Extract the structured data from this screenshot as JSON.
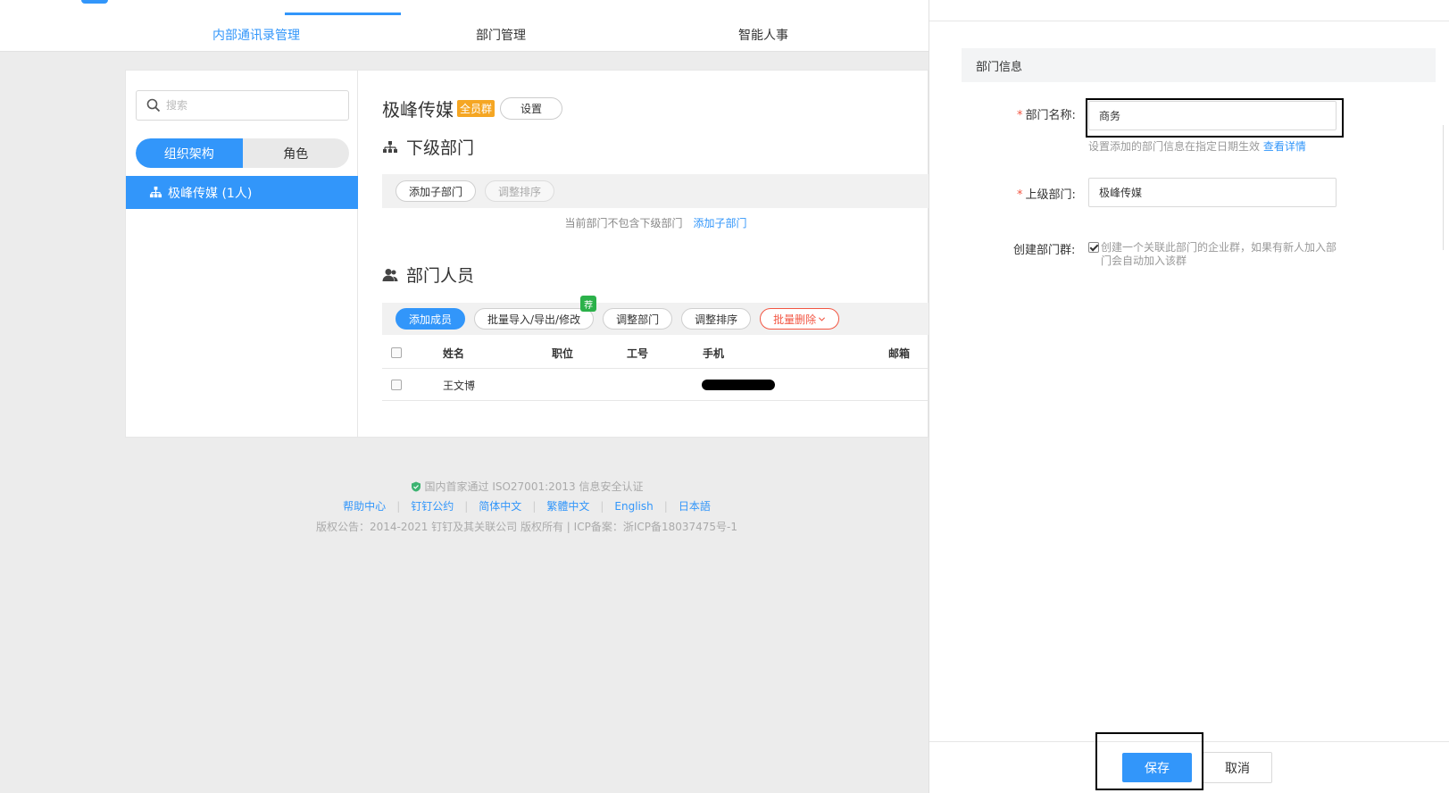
{
  "nav": {
    "tabs": [
      {
        "label": "内部通讯录管理",
        "active": true
      },
      {
        "label": "部门管理",
        "active": false
      },
      {
        "label": "智能人事",
        "active": false
      }
    ]
  },
  "sidebar": {
    "search_placeholder": "搜索",
    "segments": [
      "组织架构",
      "角色"
    ],
    "tree_item": "极峰传媒 (1人)"
  },
  "main": {
    "org_name": "极峰传媒",
    "org_badge": "全员群",
    "settings_button": "设置",
    "sub_dept_title": "下级部门",
    "add_sub_dept_button": "添加子部门",
    "sort_button": "调整排序",
    "empty_text": "当前部门不包含下级部门",
    "empty_link": "添加子部门",
    "members_title": "部门人员",
    "member_buttons": {
      "add": "添加成员",
      "batch_import": "批量导入/导出/修改",
      "recommend_tag": "荐",
      "adjust_dept": "调整部门",
      "adjust_sort": "调整排序",
      "batch_delete": "批量删除"
    },
    "table": {
      "headers": [
        "姓名",
        "职位",
        "工号",
        "手机",
        "邮箱"
      ],
      "rows": [
        {
          "name": "王文博",
          "position": "",
          "job_no": "",
          "phone_redacted": true,
          "email": ""
        }
      ]
    }
  },
  "footer": {
    "cert": "国内首家通过 ISO27001:2013 信息安全认证",
    "links": [
      "帮助中心",
      "钉钉公约",
      "简体中文",
      "繁體中文",
      "English",
      "日本語"
    ],
    "copyright": "版权公告：2014-2021 钉钉及其关联公司 版权所有 | ICP备案：浙ICP备18037475号-1"
  },
  "drawer": {
    "section_title": "部门信息",
    "dept_name_label": "部门名称:",
    "dept_name_value": "商务",
    "dept_name_hint": "设置添加的部门信息在指定日期生效",
    "dept_name_hint_link": "查看详情",
    "parent_label": "上级部门:",
    "parent_value": "极峰传媒",
    "create_group_label": "创建部门群:",
    "create_group_text": "创建一个关联此部门的企业群，如果有新人加入部门会自动加入该群",
    "create_group_checked": true,
    "save_button": "保存",
    "cancel_button": "取消"
  },
  "colors": {
    "accent": "#3296fa",
    "danger": "#f25643",
    "badge": "#f5a623",
    "recommend": "#2bb14a"
  }
}
